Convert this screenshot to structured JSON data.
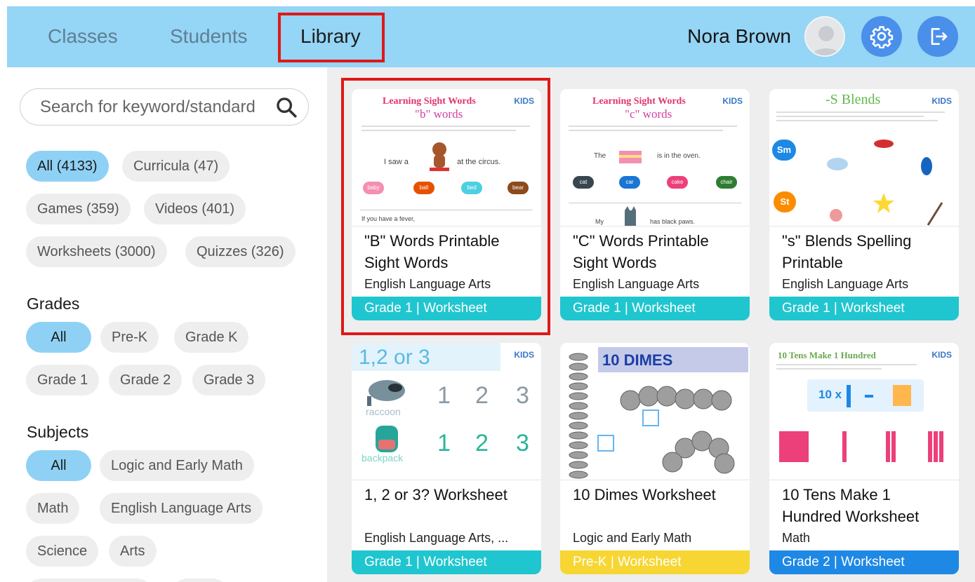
{
  "header": {
    "tabs": [
      {
        "label": "Classes"
      },
      {
        "label": "Students"
      },
      {
        "label": "Library"
      }
    ],
    "user_name": "Nora Brown",
    "icons": {
      "avatar": "user-avatar",
      "settings": "gear-icon",
      "logout": "logout-icon"
    }
  },
  "sidebar": {
    "search": {
      "placeholder": "Search for keyword/standard"
    },
    "types": [
      {
        "label": "All (4133)",
        "selected": true
      },
      {
        "label": "Curricula (47)"
      },
      {
        "label": "Games (359)"
      },
      {
        "label": "Videos (401)"
      },
      {
        "label": "Worksheets (3000)"
      },
      {
        "label": "Quizzes (326)"
      }
    ],
    "grades_heading": "Grades",
    "grades": [
      {
        "label": "All",
        "selected": true
      },
      {
        "label": "Pre-K"
      },
      {
        "label": "Grade K"
      },
      {
        "label": "Grade 1"
      },
      {
        "label": "Grade 2"
      },
      {
        "label": "Grade 3"
      }
    ],
    "subjects_heading": "Subjects",
    "subjects": [
      {
        "label": "All",
        "selected": true
      },
      {
        "label": "Logic and Early Math"
      },
      {
        "label": "Math"
      },
      {
        "label": "English Language Arts"
      },
      {
        "label": "Science"
      },
      {
        "label": "Arts"
      }
    ]
  },
  "cards": [
    {
      "title": "\"B\" Words Printable Sight Words",
      "subject": "English Language Arts",
      "footer": "Grade 1 | Worksheet",
      "footer_color": "#20c6cf",
      "thumb": {
        "heading": "Learning Sight Words",
        "sub": "\"b\" words",
        "brand": "KIDS",
        "sentence": "I saw a",
        "sentence2": "at the circus.",
        "options": [
          "baby",
          "ball",
          "bed",
          "bear"
        ],
        "line": "If you have a fever,"
      }
    },
    {
      "title": "\"C\" Words Printable Sight Words",
      "subject": "English Language Arts",
      "footer": "Grade 1 | Worksheet",
      "footer_color": "#20c6cf",
      "thumb": {
        "heading": "Learning Sight Words",
        "sub": "\"c\" words",
        "brand": "KIDS",
        "sentence": "The",
        "sentence2": "is in the oven.",
        "options": [
          "cat",
          "car",
          "cake",
          "chair"
        ],
        "line": "My",
        "line2": "has black paws."
      }
    },
    {
      "title": "\"s\" Blends Spelling Printable",
      "subject": "English Language Arts",
      "footer": "Grade 1 | Worksheet",
      "footer_color": "#20c6cf",
      "thumb": {
        "heading": "-S Blends",
        "brand": "KIDS",
        "b1": "Sm",
        "b2": "St"
      }
    },
    {
      "title": "1, 2 or 3? Worksheet",
      "subject": "English Language Arts, ...",
      "footer": "Grade 1 | Worksheet",
      "footer_color": "#20c6cf",
      "thumb": {
        "heading": "1,2 or 3",
        "brand": "KIDS",
        "w1": "raccoon",
        "w2": "backpack",
        "n1": "1",
        "n2": "2",
        "n3": "3"
      }
    },
    {
      "title": "10 Dimes Worksheet",
      "subject": "Logic and Early Math",
      "footer": "Pre-K | Worksheet",
      "footer_color": "#f7d633",
      "thumb": {
        "heading": "10 DIMES"
      }
    },
    {
      "title": "10 Tens Make 1 Hundred Worksheet",
      "subject": "Math",
      "footer": "Grade 2 | Worksheet",
      "footer_color": "#1e88e5",
      "thumb": {
        "heading": "10 Tens Make 1 Hundred",
        "brand": "KIDS",
        "eq": "10 x"
      }
    }
  ]
}
